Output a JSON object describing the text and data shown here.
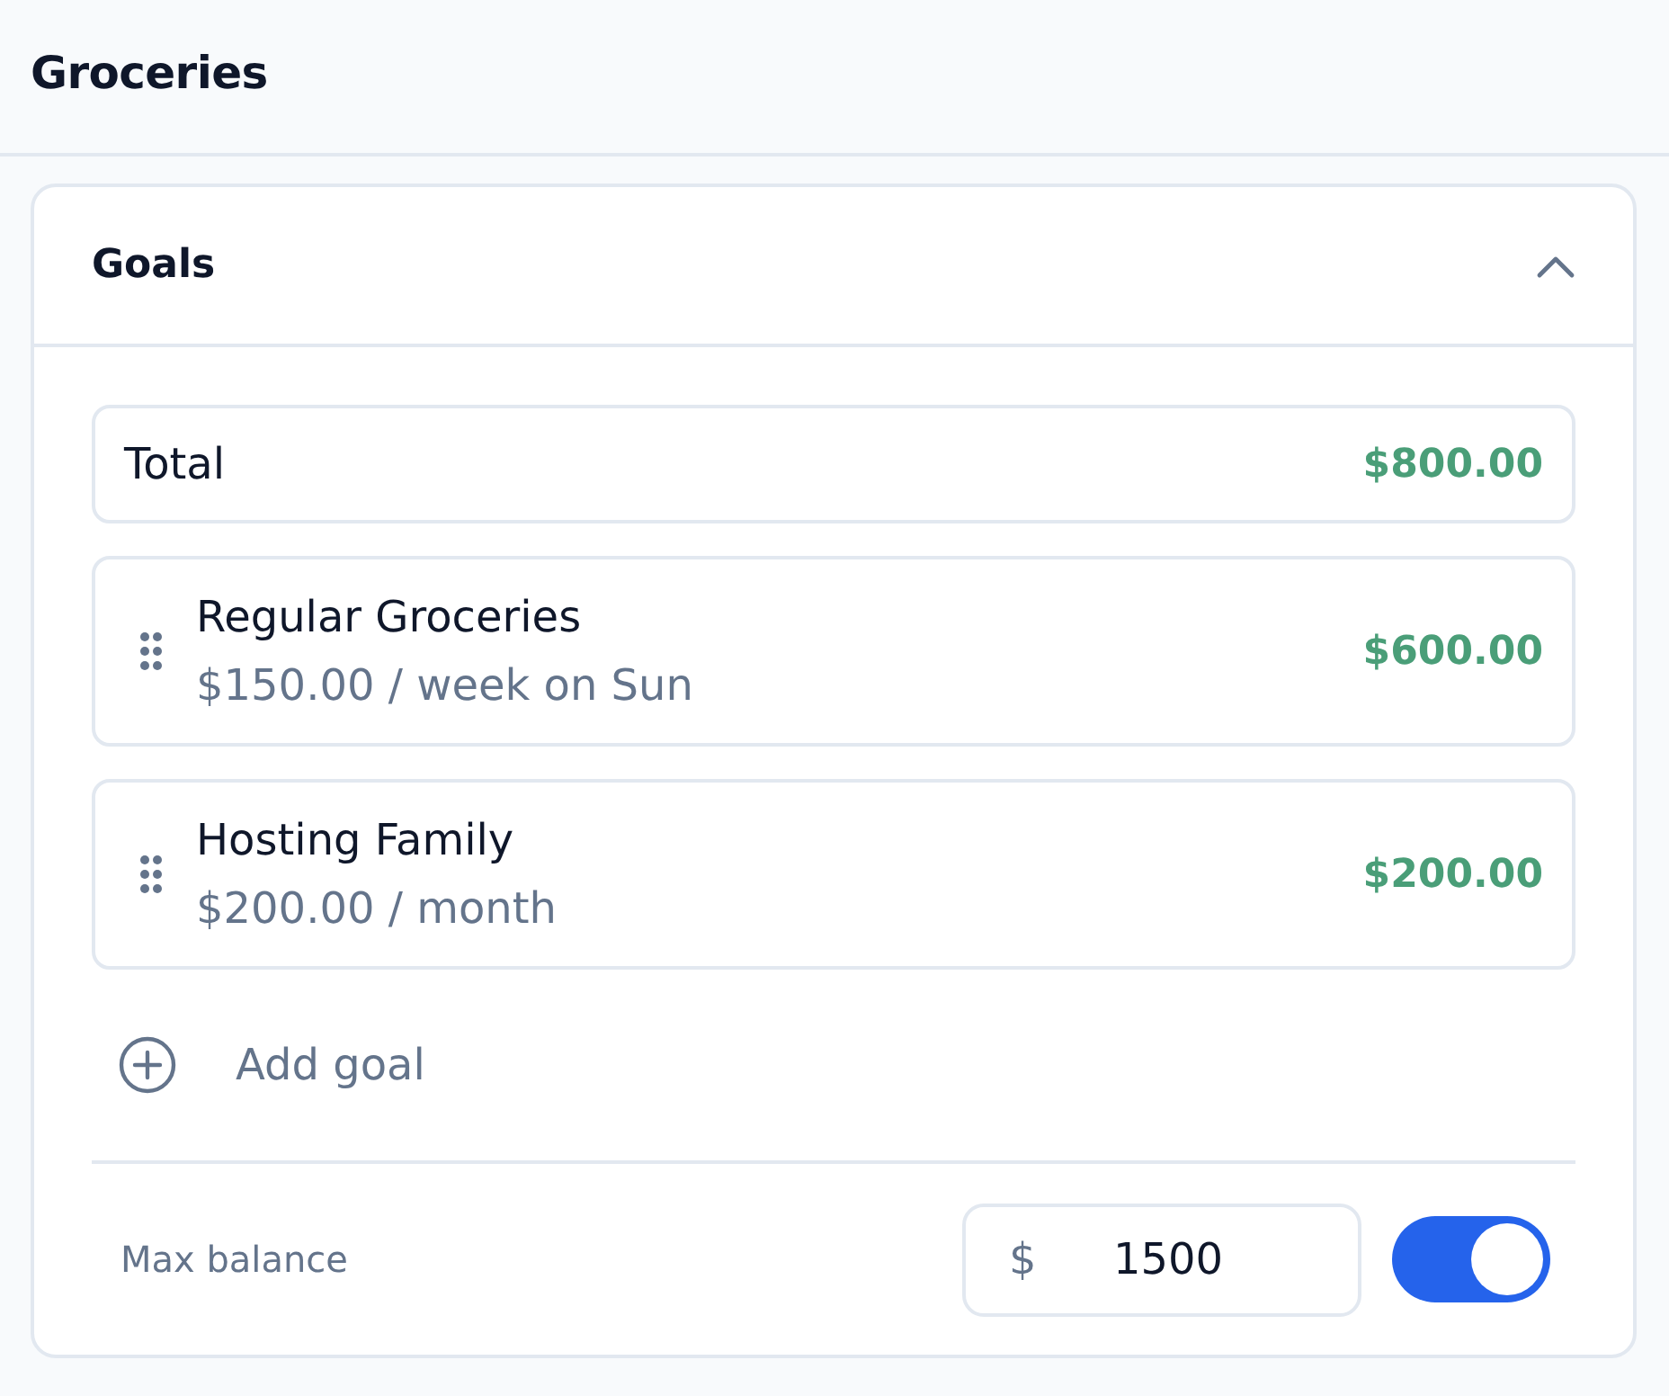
{
  "header": {
    "title": "Groceries"
  },
  "goals_panel": {
    "title": "Goals",
    "expanded": true,
    "total": {
      "label": "Total",
      "amount": "$800.00"
    },
    "goals": [
      {
        "name": "Regular Groceries",
        "schedule": "$150.00 / week on Sun",
        "amount": "$600.00"
      },
      {
        "name": "Hosting Family",
        "schedule": "$200.00 / month",
        "amount": "$200.00"
      }
    ],
    "add_button": {
      "label": "Add goal"
    },
    "max_balance": {
      "label": "Max balance",
      "currency": "$",
      "value": "1500",
      "on": true
    }
  }
}
